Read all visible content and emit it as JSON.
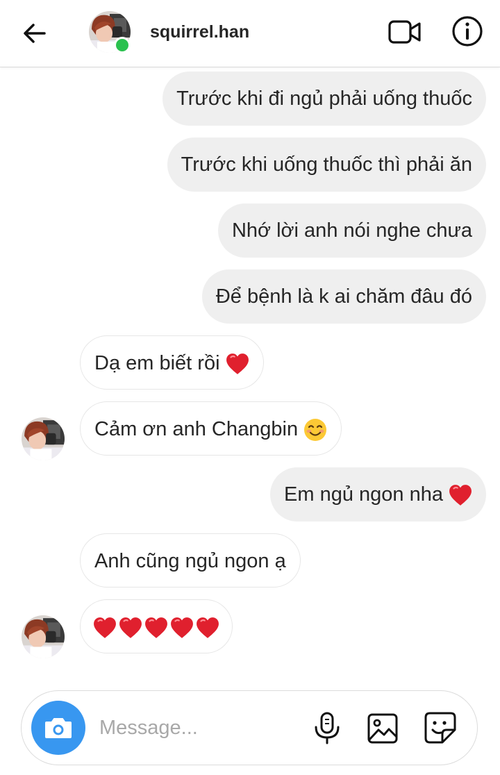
{
  "header": {
    "username": "squirrel.han",
    "online": true,
    "icons": [
      "arrow-left-icon",
      "video-camera-icon",
      "info-icon"
    ]
  },
  "messages": [
    {
      "from": "me",
      "text": "Trước khi đi ngủ phải uống thuốc"
    },
    {
      "from": "me",
      "text": "Trước khi uống thuốc thì phải ăn"
    },
    {
      "from": "me",
      "text": "Nhớ lời anh nói nghe chưa"
    },
    {
      "from": "me",
      "text": "Để bệnh là k ai chăm đâu đó"
    },
    {
      "from": "them",
      "text": "Dạ em biết rồi",
      "emoji": "heart"
    },
    {
      "from": "them",
      "text": "Cảm ơn anh Changbin",
      "emoji": "smiling-face"
    },
    {
      "from": "me",
      "text": "Em ngủ ngon nha",
      "emoji": "heart"
    },
    {
      "from": "them",
      "text": "Anh cũng ngủ ngon ạ"
    },
    {
      "from": "them",
      "text": "",
      "emoji": "heart x5"
    }
  ],
  "composer": {
    "placeholder": "Message...",
    "icons": [
      "camera-icon",
      "microphone-icon",
      "gallery-icon",
      "sticker-icon"
    ]
  },
  "colors": {
    "sent_bubble": "#efefef",
    "camera_button": "#3897f0",
    "online_dot": "#2bc14f",
    "heart": "#e0202e"
  }
}
